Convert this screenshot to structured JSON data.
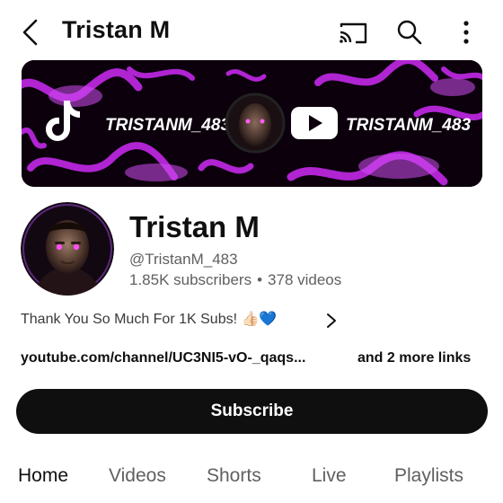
{
  "header": {
    "title": "Tristan M",
    "icons": [
      "back-icon",
      "cast-icon",
      "search-icon",
      "more-vertical-icon"
    ]
  },
  "banner": {
    "left_text": "TRISTANM_483",
    "right_text": "TRISTANM_483",
    "accent_color": "#c228e8",
    "background_color": "#0b000c"
  },
  "channel": {
    "name": "Tristan M",
    "handle": "@TristanM_483",
    "subscribers": "1.85K subscribers",
    "separator": "•",
    "videos": "378 videos",
    "description": "Thank You So Much For 1K Subs! 👍🏻💙",
    "link": "youtube.com/channel/UC3NI5-vO-_qaqs...",
    "more_links": "and 2 more links"
  },
  "actions": {
    "subscribe_label": "Subscribe"
  },
  "tabs": [
    {
      "label": "Home",
      "active": true
    },
    {
      "label": "Videos",
      "active": false
    },
    {
      "label": "Shorts",
      "active": false
    },
    {
      "label": "Live",
      "active": false
    },
    {
      "label": "Playlists",
      "active": false
    }
  ]
}
